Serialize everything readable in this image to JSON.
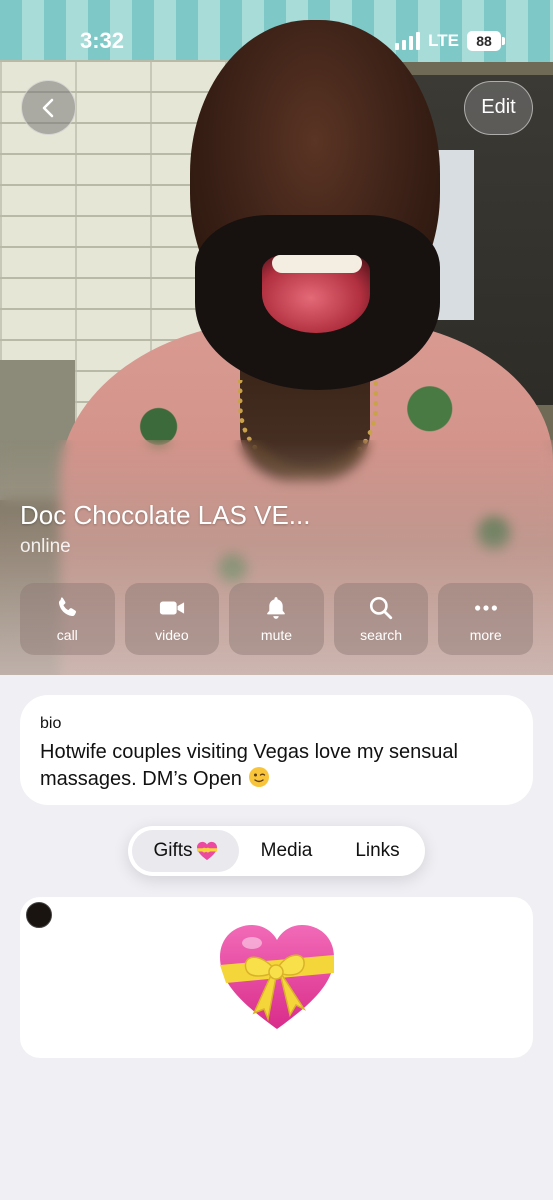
{
  "status_bar": {
    "time": "3:32",
    "network": "LTE",
    "battery": "88"
  },
  "nav": {
    "back_icon": "chevron-left-icon",
    "edit_label": "Edit"
  },
  "profile": {
    "name": "Doc Chocolate LAS VE...",
    "status": "online"
  },
  "actions": [
    {
      "label": "call",
      "icon": "phone-icon"
    },
    {
      "label": "video",
      "icon": "video-camera-icon"
    },
    {
      "label": "mute",
      "icon": "bell-icon"
    },
    {
      "label": "search",
      "icon": "magnifier-icon"
    },
    {
      "label": "more",
      "icon": "ellipsis-icon"
    }
  ],
  "bio": {
    "label": "bio",
    "text": "Hotwife couples visiting Vegas love my sensual massages. DM’s Open",
    "emoji": "winking-face-emoji"
  },
  "tabs": [
    {
      "label": "Gifts",
      "active": true,
      "icon": "heart-with-ribbon-icon"
    },
    {
      "label": "Media",
      "active": false
    },
    {
      "label": "Links",
      "active": false
    }
  ],
  "gift": {
    "icon": "heart-with-ribbon-icon",
    "sender_avatar": "avatar"
  },
  "colors": {
    "background": "#efeff4",
    "card": "#ffffff",
    "heart_pink": "#e9409a",
    "ribbon_yellow": "#f5d63a"
  }
}
